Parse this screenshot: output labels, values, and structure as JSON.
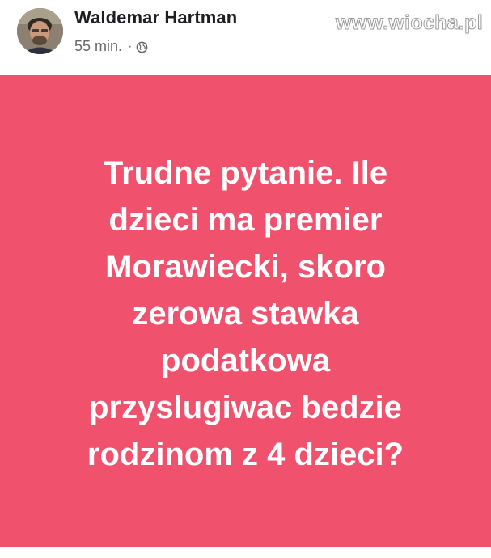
{
  "post": {
    "author": "Waldemar Hartman",
    "time": "55 min.",
    "separator": "·",
    "privacy_icon": "globe-icon",
    "text": "Trudne pytanie. Ile dzieci ma premier Morawiecki, skoro zerowa stawka podatkowa przyslugiwac bedzie rodzinom z 4 dzieci?",
    "background_color": "#f0516d",
    "text_color": "#ffffff"
  },
  "watermark": {
    "text": "www.wiocha.pl"
  }
}
